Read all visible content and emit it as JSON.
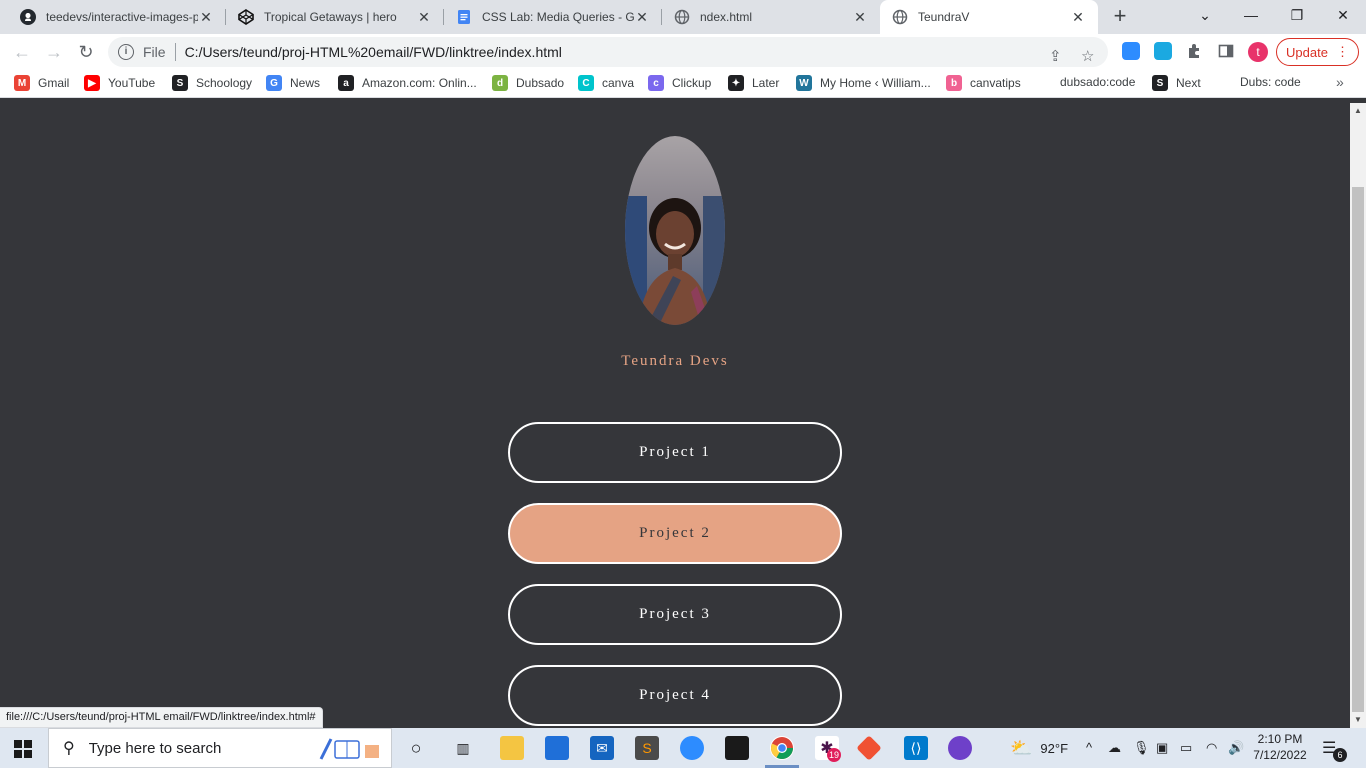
{
  "browser": {
    "tabs": [
      {
        "title": "teedevs/interactive-images-p",
        "icon": "github-icon"
      },
      {
        "title": "Tropical Getaways | hero",
        "icon": "codepen-icon"
      },
      {
        "title": "CSS Lab: Media Queries - Go",
        "icon": "google-docs-icon"
      },
      {
        "title": "ndex.html",
        "icon": "globe-icon"
      },
      {
        "title": "TeundraV",
        "icon": "globe-icon"
      }
    ],
    "address": {
      "scheme": "File",
      "url": "C:/Users/teund/proj-HTML%20email/FWD/linktree/index.html"
    },
    "update_label": "Update",
    "avatar_letter": "t",
    "bookmarks": [
      {
        "label": "Gmail",
        "icon": "gmail-icon",
        "color": "#ea4335",
        "glyph": "M"
      },
      {
        "label": "YouTube",
        "icon": "youtube-icon",
        "color": "#ff0000",
        "glyph": "▶"
      },
      {
        "label": "Schoology",
        "icon": "schoology-icon",
        "color": "#202124",
        "glyph": "S"
      },
      {
        "label": "News",
        "icon": "google-news-icon",
        "color": "#4285f4",
        "glyph": "G"
      },
      {
        "label": "Amazon.com: Onlin...",
        "icon": "amazon-icon",
        "color": "#202124",
        "glyph": "a"
      },
      {
        "label": "Dubsado",
        "icon": "dubsado-icon",
        "color": "#7cb342",
        "glyph": "d"
      },
      {
        "label": "canva",
        "icon": "canva-icon",
        "color": "#00c4cc",
        "glyph": "C"
      },
      {
        "label": "Clickup",
        "icon": "clickup-icon",
        "color": "#7b68ee",
        "glyph": "c"
      },
      {
        "label": "Later",
        "icon": "later-icon",
        "color": "#202124",
        "glyph": "✦"
      },
      {
        "label": "My Home ‹ William...",
        "icon": "wordpress-icon",
        "color": "#21759b",
        "glyph": "W"
      },
      {
        "label": "canvatips",
        "icon": "canvatips-icon",
        "color": "#f06292",
        "glyph": "b"
      },
      {
        "label": "dubsado:code",
        "icon": "",
        "color": "",
        "glyph": ""
      },
      {
        "label": "Next",
        "icon": "schoology-icon",
        "color": "#202124",
        "glyph": "S"
      },
      {
        "label": "Dubs: code",
        "icon": "",
        "color": "",
        "glyph": ""
      }
    ],
    "status_url": "file:///C:/Users/teund/proj-HTML email/FWD/linktree/index.html#"
  },
  "page": {
    "profile_alt": "profile photo",
    "name": "Teundra Devs",
    "links": [
      {
        "label": "Project 1",
        "highlighted": false
      },
      {
        "label": "Project 2",
        "highlighted": true
      },
      {
        "label": "Project 3",
        "highlighted": false
      },
      {
        "label": "Project 4",
        "highlighted": false
      }
    ],
    "colors": {
      "background": "#35363a",
      "accent": "#e5a384",
      "outline": "#ffffff"
    }
  },
  "taskbar": {
    "search_placeholder": "Type here to search",
    "weather": "92°F",
    "time": "2:10 PM",
    "date": "7/12/2022",
    "notification_count": "6",
    "slack_badge": "19"
  }
}
